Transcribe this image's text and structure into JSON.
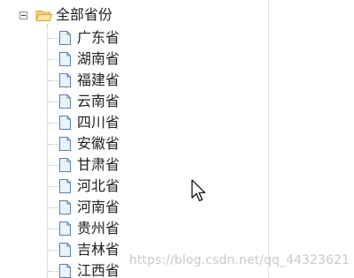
{
  "tree": {
    "root_label": "全部省份",
    "root_icons": {
      "toggle": "collapse-minus-icon",
      "folder": "folder-open-icon"
    },
    "node_icon": "document-icon",
    "items": [
      {
        "label": "广东省"
      },
      {
        "label": "湖南省"
      },
      {
        "label": "福建省"
      },
      {
        "label": "云南省"
      },
      {
        "label": "四川省"
      },
      {
        "label": "安徽省"
      },
      {
        "label": "甘肃省"
      },
      {
        "label": "河北省"
      },
      {
        "label": "河南省"
      },
      {
        "label": "贵州省"
      },
      {
        "label": "吉林省"
      },
      {
        "label": "江西省"
      }
    ]
  },
  "watermark": "https://blog.csdn.net/qq_44323621",
  "colors": {
    "file_icon_stroke": "#5b7fae",
    "file_icon_fill": "#eaf2fb",
    "folder": "#f3c86a"
  }
}
